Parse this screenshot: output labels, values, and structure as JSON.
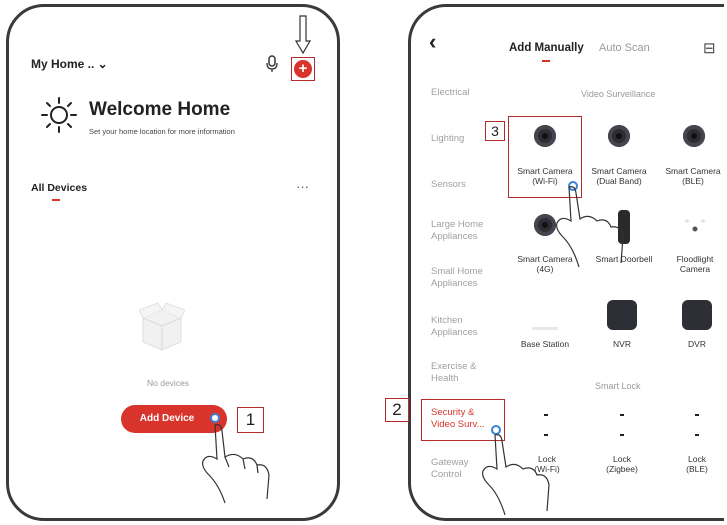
{
  "left_screen": {
    "home_selector": "My Home .. ⌄",
    "welcome_title": "Welcome Home",
    "welcome_subtitle": "Set your home location for more information",
    "section_title": "All Devices",
    "more_glyph": "···",
    "empty_text": "No devices",
    "add_device_button": "Add Device",
    "callout_1": "1",
    "icons": [
      "sun-icon",
      "mic-icon",
      "add-circle-icon",
      "arrow-down-icon",
      "empty-box-icon",
      "hand-pointer-icon"
    ]
  },
  "right_screen": {
    "back_glyph": "‹",
    "tabs": [
      "Add Manually",
      "Auto Scan"
    ],
    "scan_glyph": "⊟",
    "categories": [
      "Electrical",
      "Lighting",
      "Sensors",
      "Large Home Appliances",
      "Small Home Appliances",
      "Kitchen Appliances",
      "Exercise & Health",
      "Security & Video Surv...",
      "Gateway Control"
    ],
    "section_video": "Video Surveillance",
    "section_lock": "Smart Lock",
    "devices": [
      {
        "label": "Smart Camera (Wi-Fi)"
      },
      {
        "label": "Smart Camera (Dual Band)"
      },
      {
        "label": "Smart Camera (BLE)"
      },
      {
        "label": "Smart Camera (4G)"
      },
      {
        "label": "Smart Doorbell"
      },
      {
        "label": "Floodlight Camera"
      },
      {
        "label": "Base Station"
      },
      {
        "label": "NVR"
      },
      {
        "label": "DVR"
      }
    ],
    "locks": [
      {
        "label": "Lock (Wi-Fi)",
        "visible": "lock -Fi)"
      },
      {
        "label": "Lock (Zigbee)"
      },
      {
        "label": "Lock (BLE)"
      }
    ],
    "callout_2": "2",
    "callout_3": "3",
    "accent": "#d9342b"
  }
}
